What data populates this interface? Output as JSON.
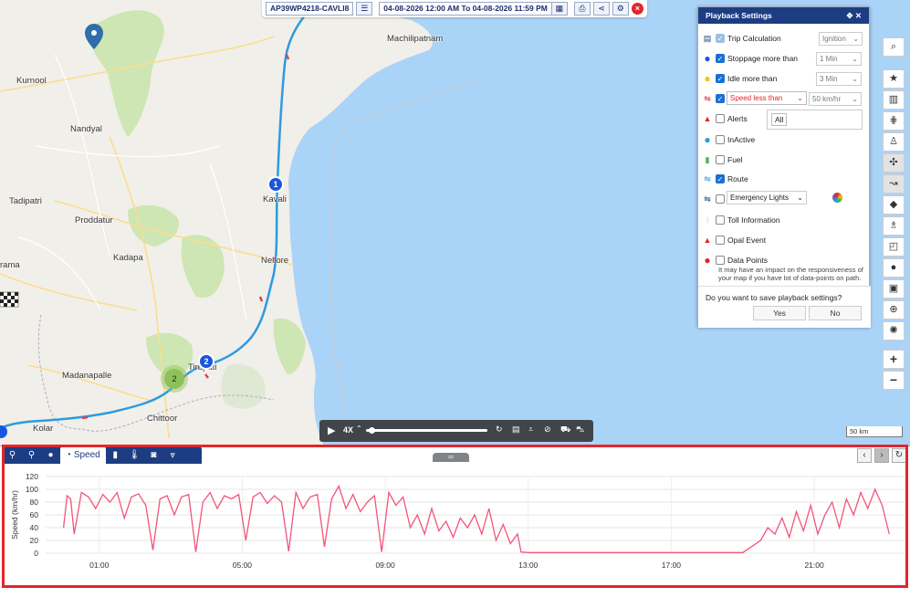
{
  "topbar": {
    "vehicle": "AP39WP4218-CAVLI8",
    "date_range": "04-08-2026 12:00 AM To 04-08-2026 11:59 PM"
  },
  "map": {
    "cities": [
      "Machilipatnam",
      "Kurnool",
      "Nandyal",
      "Kavali",
      "Tadipatri",
      "Proddatur",
      "Nellore",
      "Kadapa",
      "Madanapalle",
      "Tirupati",
      "Chittoor",
      "Kolar",
      "rama"
    ],
    "markers": [
      "1",
      "2"
    ],
    "cluster": "2",
    "scale": "50 km",
    "colors": {
      "water": "#aad3f8",
      "land": "#f1efe9",
      "route": "#2c9be0",
      "park": "#cde6b3"
    }
  },
  "panel": {
    "title": "Playback Settings",
    "rows": [
      {
        "label": "Trip Calculation",
        "checked": true,
        "icon": "calculator-icon",
        "select": "Ignition"
      },
      {
        "label": "Stoppage more than",
        "checked": true,
        "icon": "blue-dot-icon",
        "select": "1 Min"
      },
      {
        "label": "Idle more than",
        "checked": true,
        "icon": "yellow-dot-icon",
        "select": "3 Min"
      },
      {
        "label": "Speed less than",
        "checked": true,
        "icon": "speed-route-icon",
        "select": "50 km/hr"
      },
      {
        "label": "Alerts",
        "checked": false,
        "icon": "alert-triangle-icon",
        "select": "All"
      },
      {
        "label": "InActive",
        "checked": false,
        "icon": "inactive-dot-icon"
      },
      {
        "label": "Fuel",
        "checked": false,
        "icon": "fuel-icon"
      },
      {
        "label": "Route",
        "checked": true,
        "icon": "route-icon"
      },
      {
        "label": "Emergency Lights",
        "checked": false,
        "icon": "emergency-route-icon"
      },
      {
        "label": "Toll Information",
        "checked": false,
        "icon": "toll-icon"
      },
      {
        "label": "Opal Event",
        "checked": false,
        "icon": "opal-icon"
      },
      {
        "label": "Data Points",
        "checked": false,
        "icon": "red-dot-icon"
      }
    ],
    "note": "It may have an impact on the responsiveness of your map if you have lot of data-points on path.",
    "save_question": "Do you want to save playback settings?",
    "yes": "Yes",
    "no": "No"
  },
  "playback": {
    "speed": "4X",
    "progress": 0.02
  },
  "bottom": {
    "tabs": [
      {
        "icon": "route-pin-icon"
      },
      {
        "icon": "pin-icon"
      },
      {
        "icon": "circle-icon"
      },
      {
        "icon": "speedometer-icon",
        "label": "Speed"
      },
      {
        "icon": "fuel-icon"
      },
      {
        "icon": "thermometer-icon"
      },
      {
        "icon": "camera-icon"
      },
      {
        "icon": "expand-more-icon"
      }
    ]
  },
  "chart_data": {
    "type": "line",
    "ylabel": "Speed (km/hr)",
    "xlabel": "",
    "ylim": [
      0,
      120
    ],
    "yticks": [
      0,
      20,
      40,
      60,
      80,
      100,
      120
    ],
    "xticks": [
      "01:00",
      "05:00",
      "09:00",
      "13:00",
      "17:00",
      "21:00"
    ],
    "xlim_hours": [
      -0.5,
      23.5
    ],
    "grid": true,
    "color": "#f2557a",
    "series": [
      {
        "x_hours": [
          0.0,
          0.1,
          0.2,
          0.3,
          0.5,
          0.7,
          0.9,
          1.1,
          1.3,
          1.5,
          1.7,
          1.9,
          2.1,
          2.3,
          2.5,
          2.7,
          2.9,
          3.1,
          3.3,
          3.5,
          3.7,
          3.9,
          4.1,
          4.3,
          4.5,
          4.7,
          4.9,
          5.1,
          5.3,
          5.5,
          5.7,
          5.9,
          6.1,
          6.3,
          6.5,
          6.7,
          6.9,
          7.1,
          7.3,
          7.5,
          7.7,
          7.9,
          8.1,
          8.3,
          8.5,
          8.7,
          8.9,
          9.1,
          9.3,
          9.5,
          9.7,
          9.9,
          10.1,
          10.3,
          10.5,
          10.7,
          10.9,
          11.1,
          11.3,
          11.5,
          11.7,
          11.9,
          12.1,
          12.3,
          12.5,
          12.7,
          12.8,
          13.0,
          14,
          15,
          16,
          17,
          18,
          19,
          19.5,
          19.7,
          19.9,
          20.1,
          20.3,
          20.5,
          20.7,
          20.9,
          21.1,
          21.3,
          21.5,
          21.7,
          21.9,
          22.1,
          22.3,
          22.5,
          22.7,
          22.9,
          23.1
        ],
        "y": [
          40,
          90,
          85,
          30,
          95,
          88,
          70,
          92,
          80,
          95,
          55,
          88,
          93,
          75,
          5,
          85,
          90,
          60,
          88,
          92,
          2,
          80,
          95,
          70,
          90,
          85,
          92,
          20,
          88,
          95,
          78,
          90,
          80,
          3,
          95,
          70,
          88,
          92,
          10,
          85,
          105,
          70,
          92,
          65,
          80,
          90,
          2,
          95,
          75,
          88,
          40,
          60,
          30,
          70,
          35,
          50,
          25,
          55,
          40,
          60,
          30,
          70,
          20,
          45,
          15,
          30,
          2,
          1,
          1,
          1,
          1,
          1,
          1,
          1,
          20,
          40,
          30,
          55,
          25,
          65,
          35,
          75,
          30,
          60,
          80,
          40,
          85,
          60,
          95,
          70,
          100,
          75,
          30
        ]
      }
    ]
  }
}
